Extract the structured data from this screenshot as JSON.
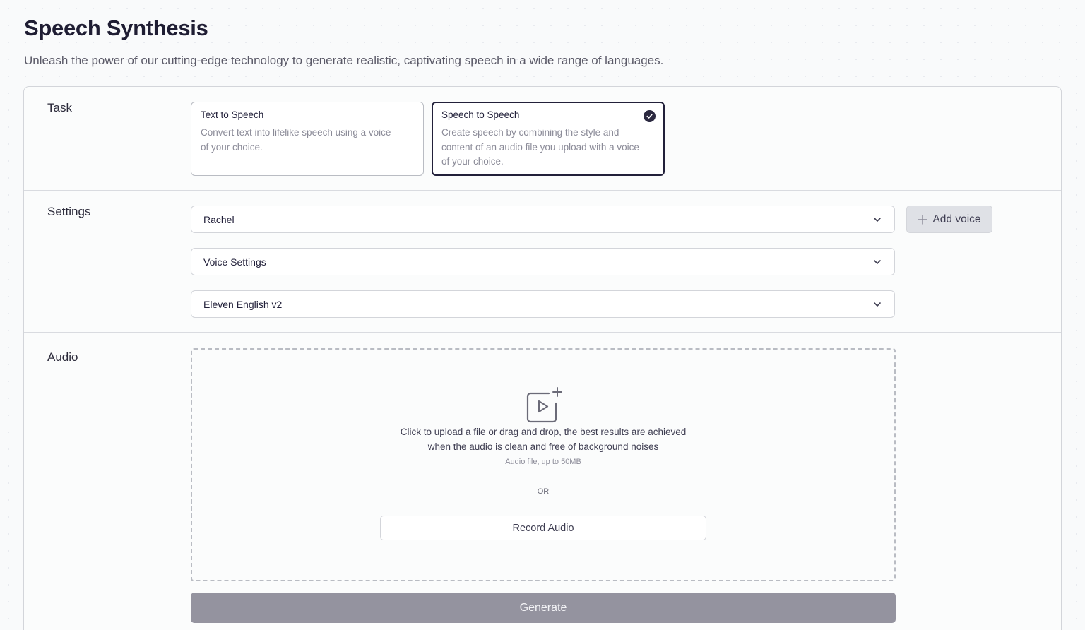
{
  "header": {
    "title": "Speech Synthesis",
    "subtitle": "Unleash the power of our cutting-edge technology to generate realistic, captivating speech in a wide range of languages."
  },
  "task": {
    "label": "Task",
    "options": [
      {
        "title": "Text to Speech",
        "description": "Convert text into lifelike speech using a voice of your choice.",
        "selected": false
      },
      {
        "title": "Speech to Speech",
        "description": "Create speech by combining the style and content of an audio file you upload with a voice of your choice.",
        "selected": true
      }
    ]
  },
  "settings": {
    "label": "Settings",
    "voice": "Rachel",
    "voice_settings": "Voice Settings",
    "model": "Eleven English v2",
    "add_voice_label": "Add voice"
  },
  "audio": {
    "label": "Audio",
    "upload_line1": "Click to upload a file or drag and drop, the best results are achieved",
    "upload_line2": "when the audio is clean and free of background noises",
    "upload_hint": "Audio file, up to 50MB",
    "or_text": "OR",
    "record_label": "Record Audio"
  },
  "generate_label": "Generate",
  "colors": {
    "accent_dark": "#22203a",
    "generate_disabled": "#94939f",
    "border": "#d3d5da"
  },
  "icons": {
    "selected_check": "check-circle-icon",
    "chevron": "chevron-down-icon",
    "plus": "plus-icon",
    "upload": "video-file-plus-icon"
  }
}
